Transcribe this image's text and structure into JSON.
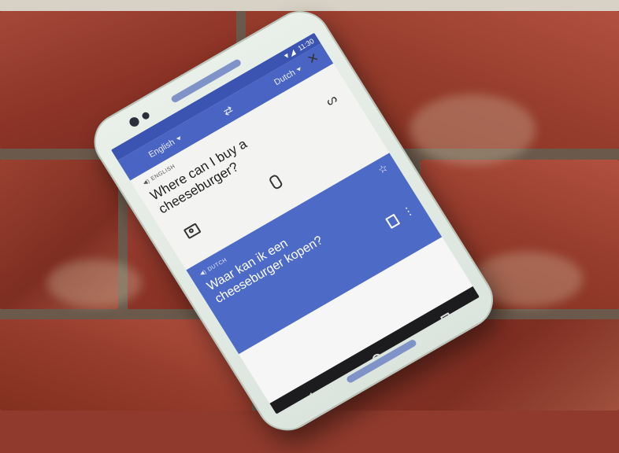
{
  "status_bar": {
    "time": "11:30"
  },
  "toolbar": {
    "source_language": "English",
    "target_language": "Dutch",
    "swap_icon": "swap-arrows-icon"
  },
  "source": {
    "label": "ENGLISH",
    "text": "Where can I buy a cheeseburger?",
    "close_icon": "close-icon"
  },
  "result": {
    "label": "DUTCH",
    "text": "Waar kan ik een cheeseburger kopen?"
  },
  "icons": [
    "speaker-icon",
    "handwriting-icon",
    "mic-icon",
    "camera-icon",
    "star-icon",
    "copy-icon",
    "more-vert-icon",
    "nav-back-icon",
    "nav-home-icon",
    "nav-recent-icon"
  ],
  "colors": {
    "toolbar": "#4a64c4",
    "result_card": "#4d6bc6",
    "phone_body": "#e4ece6",
    "brick": "#8f3a2c"
  }
}
